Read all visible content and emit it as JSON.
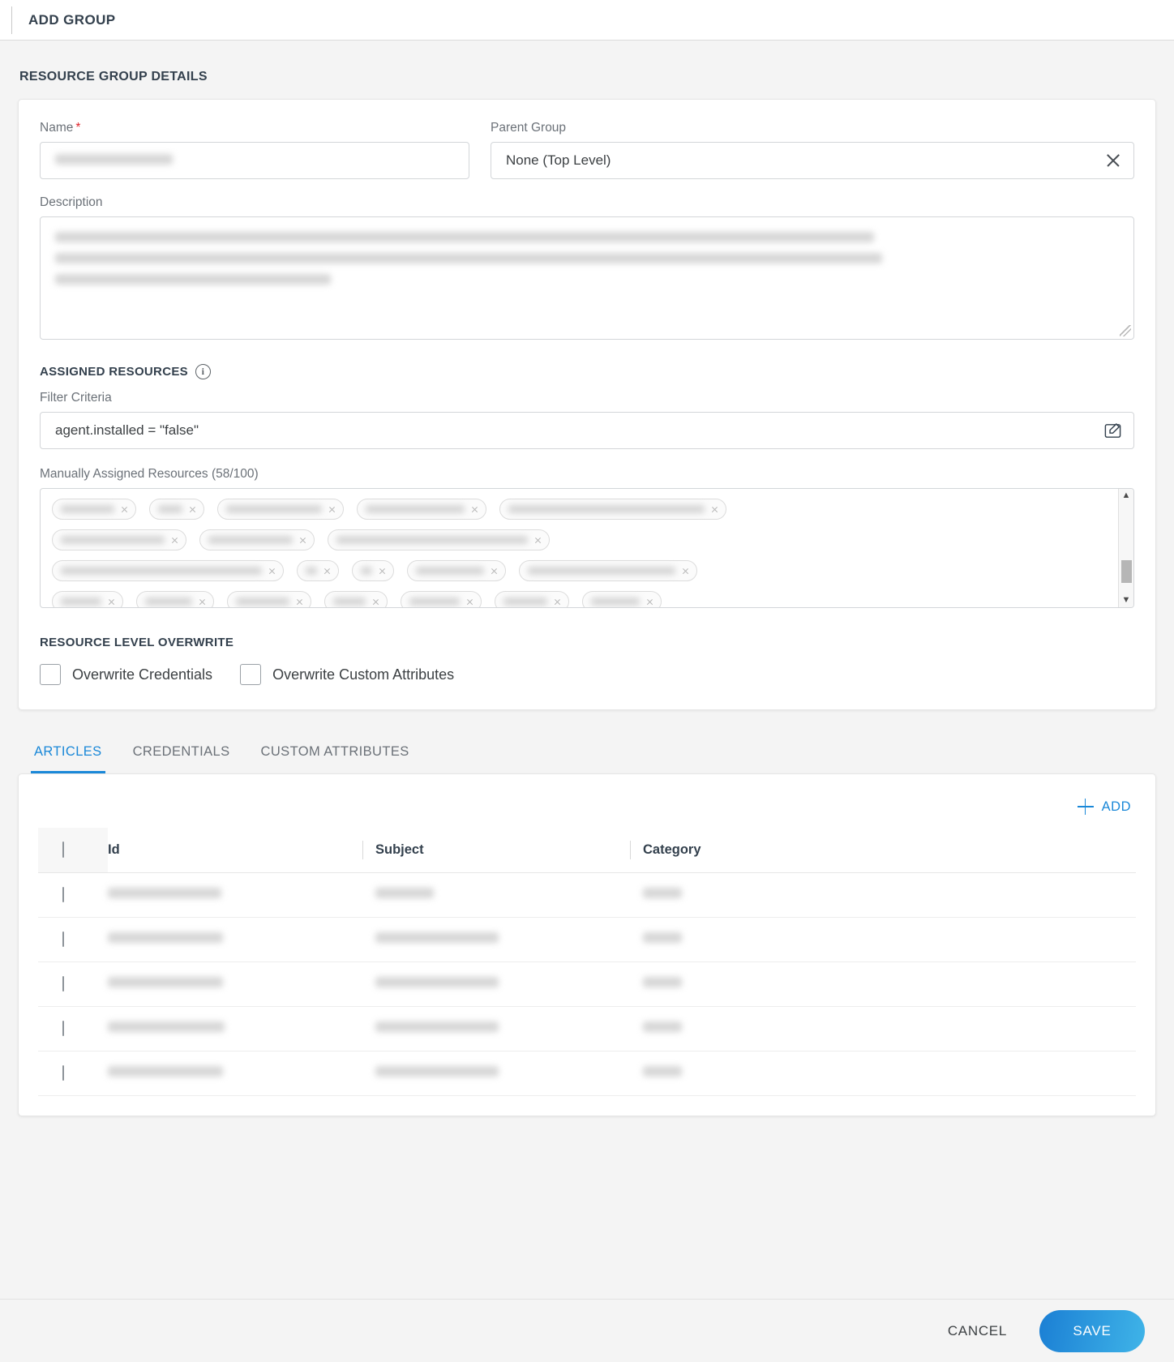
{
  "header": {
    "title": "ADD GROUP"
  },
  "details": {
    "section_title": "RESOURCE GROUP DETAILS",
    "name_label": "Name",
    "name_required_mark": "*",
    "name_value": "",
    "parent_group_label": "Parent Group",
    "parent_group_value": "None (Top Level)",
    "description_label": "Description",
    "description_value": ""
  },
  "assigned": {
    "section_title": "ASSIGNED RESOURCES",
    "info_glyph": "i",
    "filter_label": "Filter Criteria",
    "filter_value": "agent.installed = \"false\"",
    "manual_label": "Manually Assigned Resources (58/100)",
    "scroll_up_glyph": "▲",
    "scroll_down_glyph": "▼"
  },
  "overwrite": {
    "section_title": "RESOURCE LEVEL OVERWRITE",
    "credentials_label": "Overwrite Credentials",
    "credentials_checked": false,
    "custom_attributes_label": "Overwrite Custom Attributes",
    "custom_attributes_checked": false
  },
  "tabs": {
    "items": [
      {
        "label": "ARTICLES",
        "active": true
      },
      {
        "label": "CREDENTIALS",
        "active": false
      },
      {
        "label": "CUSTOM ATTRIBUTES",
        "active": false
      }
    ]
  },
  "articles_table": {
    "add_label": "ADD",
    "columns": [
      "Id",
      "Subject",
      "Category"
    ],
    "rows": [
      {
        "id": "",
        "subject": "",
        "category": ""
      },
      {
        "id": "",
        "subject": "",
        "category": ""
      },
      {
        "id": "",
        "subject": "",
        "category": ""
      },
      {
        "id": "",
        "subject": "",
        "category": ""
      },
      {
        "id": "",
        "subject": "",
        "category": ""
      }
    ]
  },
  "footer": {
    "cancel_label": "CANCEL",
    "save_label": "SAVE"
  },
  "colors": {
    "accent_blue": "#1a88d8",
    "save_gradient_from": "#1b7fd4",
    "save_gradient_to": "#3fb4e8",
    "required_red": "#e0242b",
    "page_background": "#f4f4f4"
  }
}
